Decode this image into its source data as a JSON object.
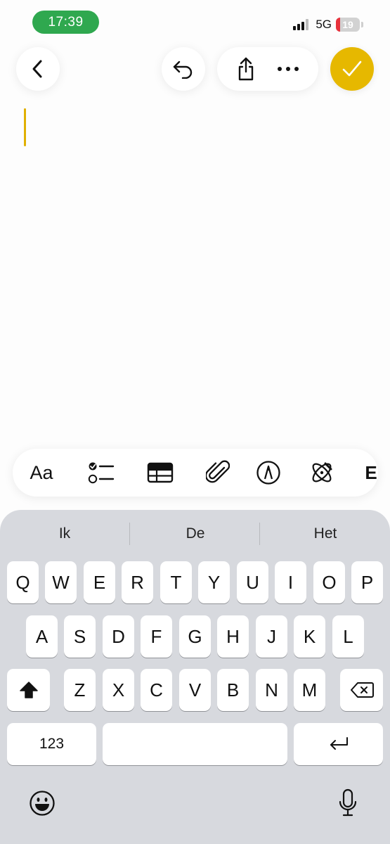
{
  "status_bar": {
    "time": "17:39",
    "network": "5G",
    "battery_level": "19",
    "signal_bars_on": 3,
    "signal_bars_total": 4
  },
  "toolbar": {
    "back_icon": "chevron-left-icon",
    "undo_icon": "undo-icon",
    "share_icon": "share-icon",
    "more_icon": "ellipsis-icon",
    "done_icon": "checkmark-icon",
    "accent_color": "#e6b800"
  },
  "format_bar": {
    "text_style_label": "Aa",
    "items": [
      "checklist-icon",
      "table-icon",
      "attachment-icon",
      "markup-pen-icon",
      "writing-tools-icon"
    ]
  },
  "keyboard": {
    "suggestions": [
      "Ik",
      "De",
      "Het"
    ],
    "row1": [
      "Q",
      "W",
      "E",
      "R",
      "T",
      "Y",
      "U",
      "I",
      "O",
      "P"
    ],
    "row2": [
      "A",
      "S",
      "D",
      "F",
      "G",
      "H",
      "J",
      "K",
      "L"
    ],
    "row3": [
      "Z",
      "X",
      "C",
      "V",
      "B",
      "N",
      "M"
    ],
    "numbers_label": "123",
    "space_label": "",
    "shift_icon": "shift-icon",
    "delete_icon": "delete-icon",
    "return_icon": "return-icon",
    "emoji_icon": "emoji-icon",
    "dictation_icon": "microphone-icon"
  }
}
